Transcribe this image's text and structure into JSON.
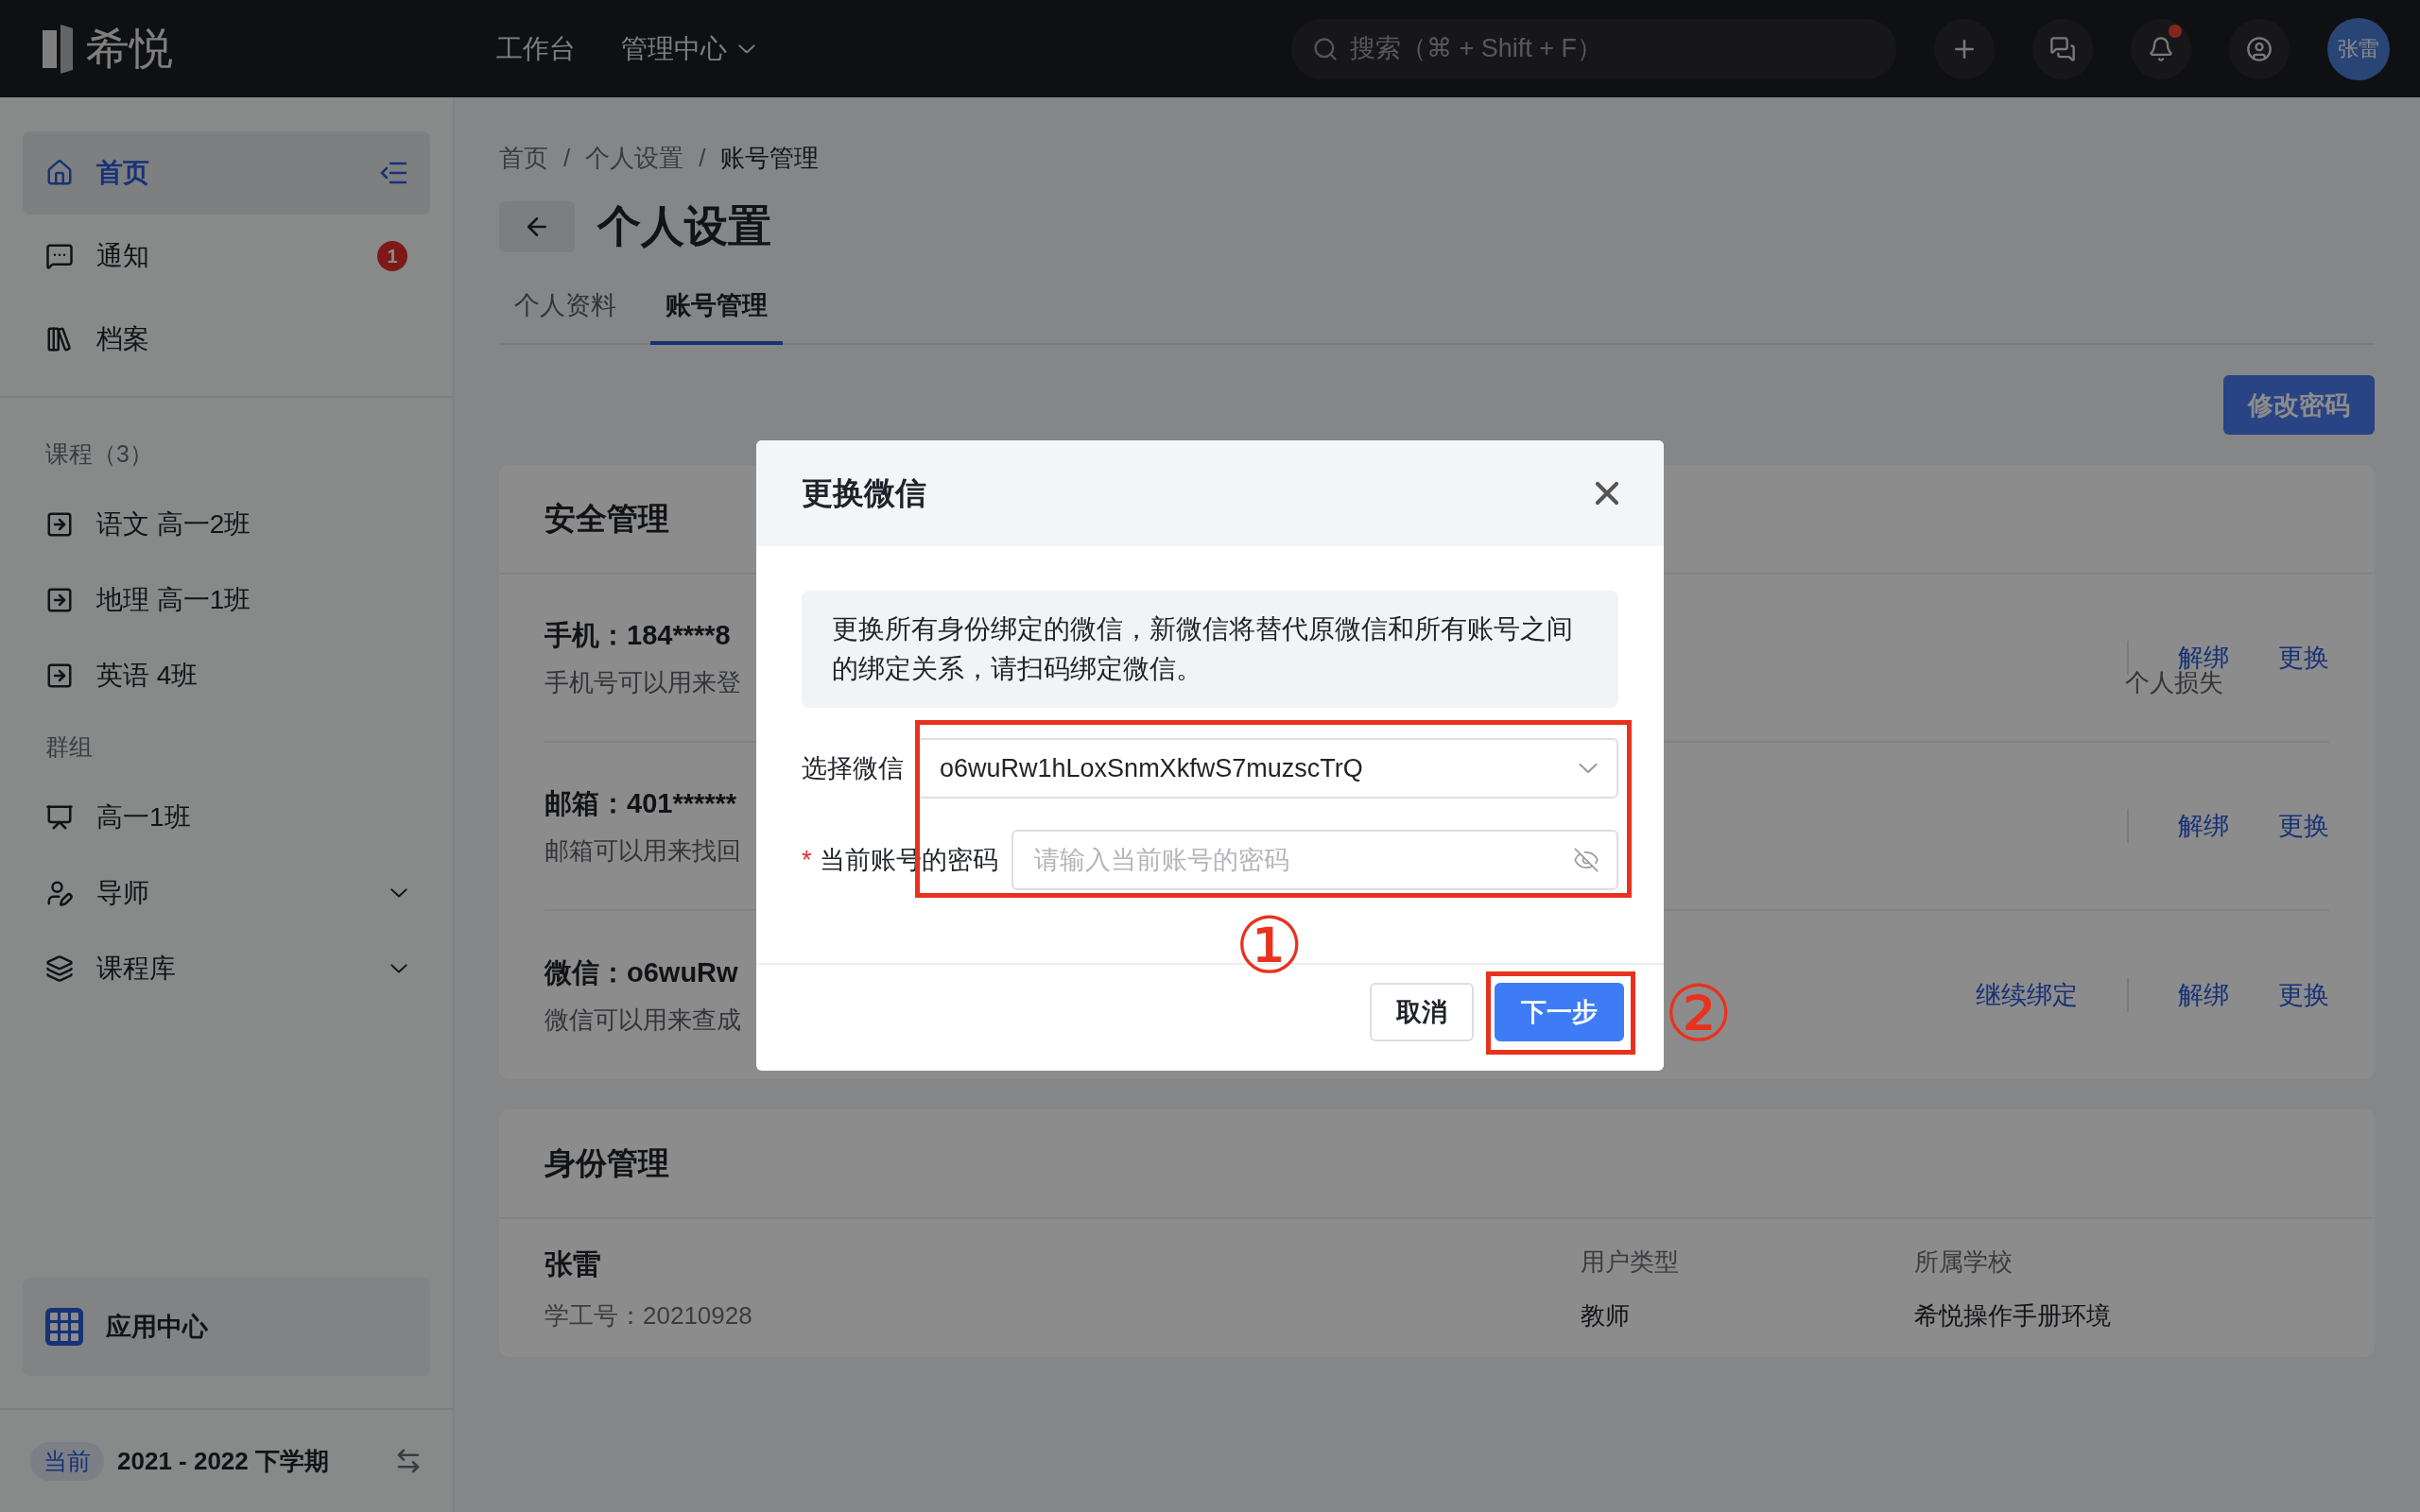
{
  "topbar": {
    "logo": "希悦",
    "nav": [
      {
        "label": "工作台",
        "dropdown": false
      },
      {
        "label": "管理中心",
        "dropdown": true
      }
    ],
    "search": {
      "placeholder": "搜索（⌘ + Shift + F）"
    },
    "notification_dot": true,
    "avatar": "张雷"
  },
  "sidebar": {
    "main_items": [
      {
        "label": "首页",
        "selected": true
      },
      {
        "label": "通知",
        "selected": false,
        "badge": "1"
      },
      {
        "label": "档案",
        "selected": false
      }
    ],
    "course_heading": "课程（3）",
    "courses": [
      {
        "label": "语文 高一2班",
        "selected": false
      },
      {
        "label": "地理 高一1班",
        "selected": false
      },
      {
        "label": "英语 4班",
        "selected": false
      }
    ],
    "group_heading": "群组",
    "groups": [
      {
        "label": "高一1班",
        "selected": false,
        "expandable": false
      },
      {
        "label": "导师",
        "selected": false,
        "expandable": true
      },
      {
        "label": "课程库",
        "selected": false,
        "expandable": true
      }
    ],
    "app_center": "应用中心",
    "term": {
      "tag": "当前",
      "label": "2021 - 2022 下学期"
    }
  },
  "main": {
    "breadcrumb": [
      "首页",
      "/",
      "个人设置",
      "/",
      "账号管理"
    ],
    "title": "个人设置",
    "tabs": [
      {
        "label": "个人资料",
        "selected": false
      },
      {
        "label": "账号管理",
        "selected": true
      }
    ],
    "change_password_button": "修改密码",
    "security": {
      "title": "安全管理",
      "rows": [
        {
          "title": "手机：184****8",
          "description": "手机号可以用来登",
          "description_tail": "个人损失",
          "actions": [
            "解绑",
            "更换"
          ]
        },
        {
          "title": "邮箱：401******",
          "description": "邮箱可以用来找回",
          "actions": [
            "解绑",
            "更换"
          ]
        },
        {
          "title": "微信：o6wuRw",
          "description": "微信可以用来查成",
          "actions": [
            "继续绑定",
            "解绑",
            "更换"
          ]
        }
      ]
    },
    "identity": {
      "title": "身份管理",
      "name": "张雷",
      "id_label": "学工号：20210928",
      "columns": [
        {
          "header": "用户类型",
          "value": "教师"
        },
        {
          "header": "所属学校",
          "value": "希悦操作手册环境"
        }
      ]
    }
  },
  "modal": {
    "title": "更换微信",
    "notice": "更换所有身份绑定的微信，新微信将替代原微信和所有账号之间的绑定关系，请扫码绑定微信。",
    "fields": [
      {
        "kind": "select",
        "label": "选择微信",
        "value": "o6wuRw1hLoxSnmXkfwS7muzscTrQ"
      },
      {
        "kind": "password",
        "label": "当前账号的密码",
        "required_mark": "*",
        "placeholder": "请输入当前账号的密码"
      }
    ],
    "buttons": [
      {
        "label": "取消",
        "primary": false
      },
      {
        "label": "下一步",
        "primary": true
      }
    ]
  },
  "annotations": [
    "①",
    "②"
  ]
}
